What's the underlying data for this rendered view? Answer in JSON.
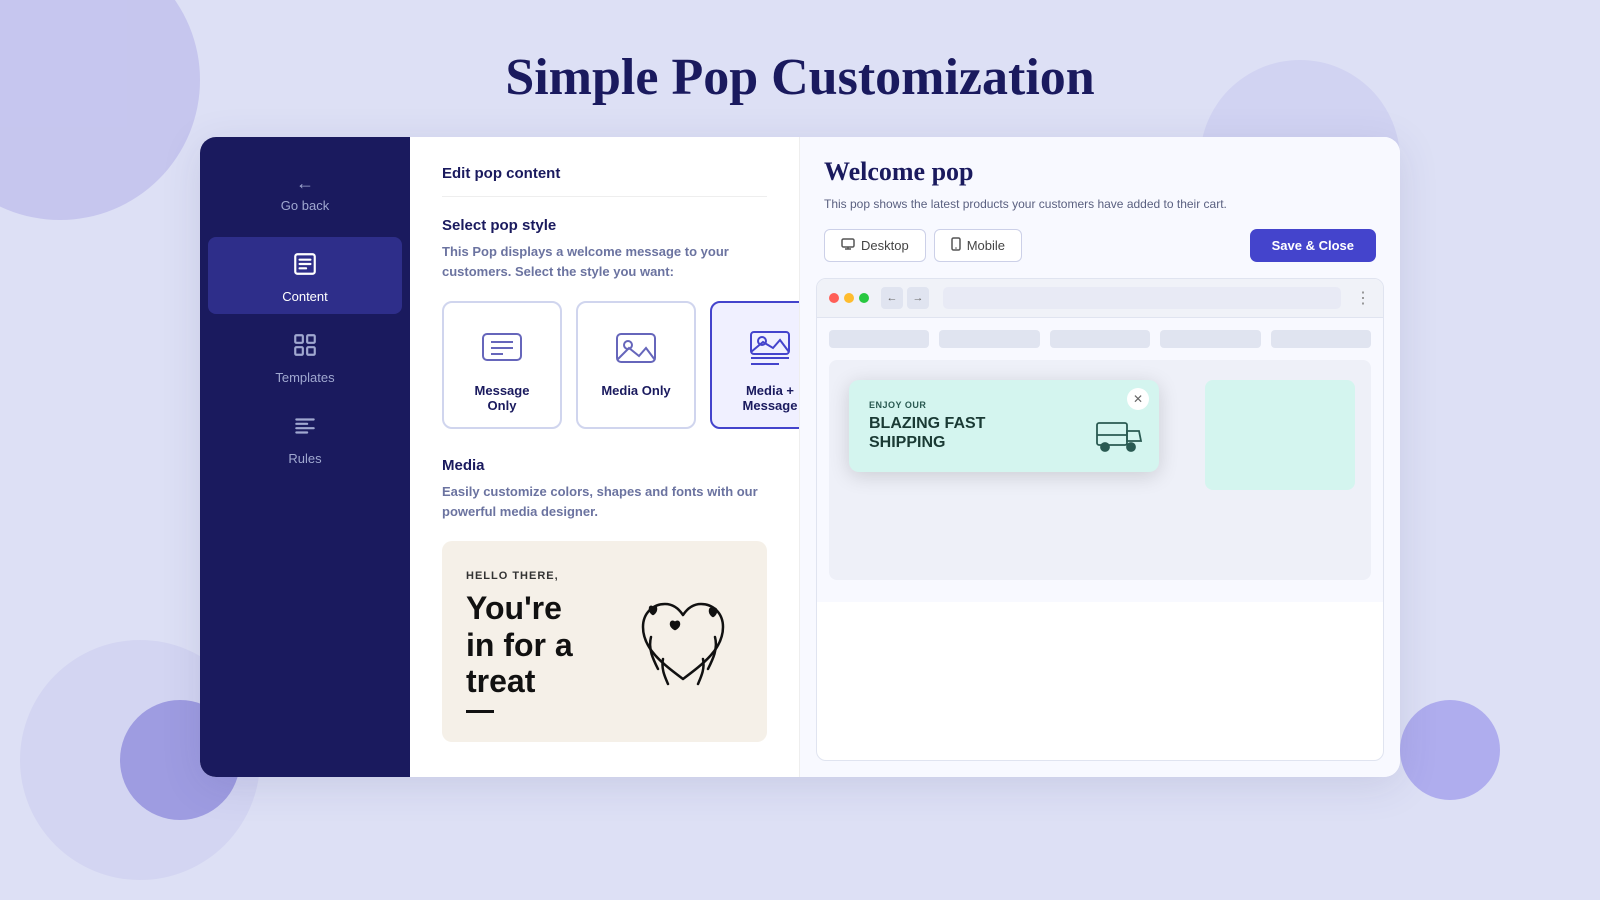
{
  "page": {
    "title": "Simple Pop Customization"
  },
  "sidebar": {
    "back_label": "Go back",
    "items": [
      {
        "id": "content",
        "label": "Content",
        "active": true
      },
      {
        "id": "templates",
        "label": "Templates",
        "active": false
      },
      {
        "id": "rules",
        "label": "Rules",
        "active": false
      }
    ]
  },
  "content": {
    "section_title": "Edit pop content",
    "style_section": {
      "title": "Select pop style",
      "desc": "This Pop displays a welcome message to your customers. Select the style you want:",
      "cards": [
        {
          "id": "message-only",
          "label": "Message Only",
          "selected": false
        },
        {
          "id": "media-only",
          "label": "Media Only",
          "selected": false
        },
        {
          "id": "media-message",
          "label": "Media + Message",
          "selected": true
        }
      ]
    },
    "media_section": {
      "title": "Media",
      "desc": "Easily customize colors, shapes and fonts with our powerful media designer.",
      "preview": {
        "hello_text": "HELLO THERE,",
        "headline_line1": "You're",
        "headline_line2": "in for a",
        "headline_line3": "treat"
      }
    }
  },
  "preview": {
    "title": "Welcome pop",
    "desc": "This pop shows the latest products your customers have added to their cart.",
    "desktop_label": "Desktop",
    "mobile_label": "Mobile",
    "save_label": "Save & Close",
    "popup": {
      "small_text": "ENJOY OUR",
      "headline_line1": "BLAZING FAST",
      "headline_line2": "SHIPPING"
    }
  }
}
